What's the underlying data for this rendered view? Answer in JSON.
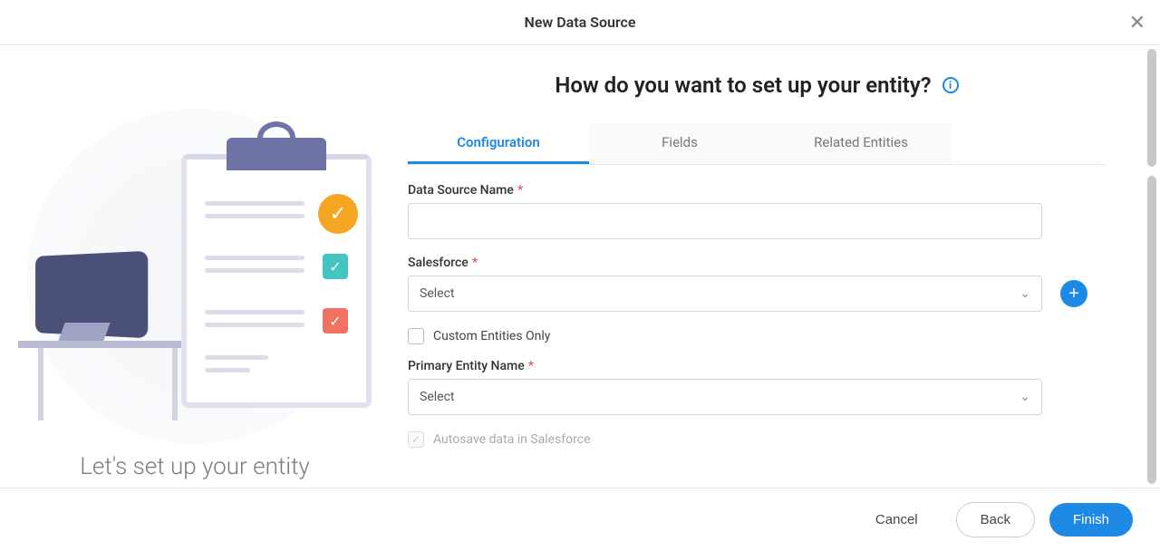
{
  "dialog": {
    "title": "New Data Source"
  },
  "left": {
    "caption": "Let's set up your entity"
  },
  "right": {
    "heading": "How do you want to set up your entity?",
    "tabs": [
      {
        "label": "Configuration",
        "active": true
      },
      {
        "label": "Fields",
        "active": false
      },
      {
        "label": "Related Entities",
        "active": false
      }
    ],
    "form": {
      "data_source_name_label": "Data Source Name",
      "data_source_name_value": "",
      "salesforce_label": "Salesforce",
      "salesforce_value": "Select",
      "custom_entities_label": "Custom Entities Only",
      "custom_entities_checked": false,
      "primary_entity_label": "Primary Entity Name",
      "primary_entity_value": "Select",
      "autosave_label": "Autosave data in Salesforce",
      "autosave_checked": true,
      "autosave_disabled": true
    }
  },
  "footer": {
    "cancel": "Cancel",
    "back": "Back",
    "finish": "Finish"
  }
}
